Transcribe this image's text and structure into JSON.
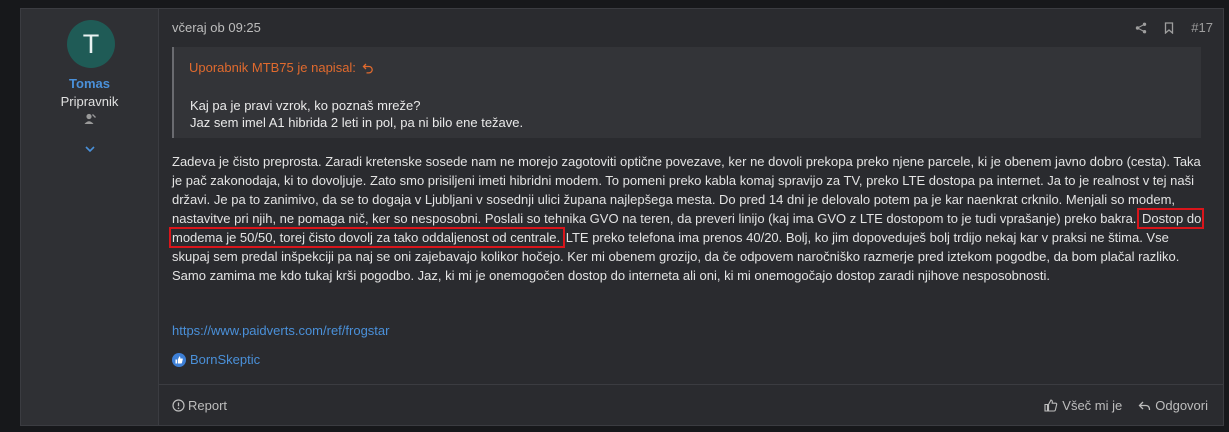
{
  "user": {
    "avatar_letter": "T",
    "avatar_color": "#1f5b56",
    "name": "Tomas",
    "title": "Pripravnik",
    "badge_icon": "user-badge-icon",
    "expand_icon": "chevron-down-icon"
  },
  "post": {
    "date": "včeraj ob 09:25",
    "number": "#17",
    "share_icon": "share-icon",
    "bookmark_icon": "bookmark-icon"
  },
  "quote": {
    "header": "Uporabnik MTB75 je napisal:",
    "header_color": "#e06a2e",
    "lines": [
      "Kaj pa je pravi vzrok, ko poznaš mreže?",
      "Jaz sem imel A1 hibrida 2 leti in pol, pa ni bilo ene težave."
    ]
  },
  "message": {
    "before": "Zadeva je čisto preprosta. Zaradi kretenske sosede nam ne morejo zagotoviti optične povezave, ker ne dovoli prekopa preko njene parcele, ki je obenem javno dobro (cesta). Taka je pač zakonodaja, ki to dovoljuje. Zato smo prisiljeni imeti hibridni modem. To pomeni preko kabla komaj spravijo za TV, preko LTE dostopa pa internet. Ja to je realnost v tej naši državi. Je pa to zanimivo, da se to dogaja v Ljubljani v sosednji ulici župana najlepšega mesta. Do pred 14 dni je delovalo potem pa je kar naenkrat crknilo. Menjali so modem, nastavitve pri njih, ne pomaga nič, ker so nesposobni. Poslali so tehnika GVO na teren, da preveri linijo (kaj ima GVO z LTE dostopom to je tudi vprašanje) preko bakra.",
    "highlight": "Dostop do modema je 50/50, torej čisto dovolj za tako oddaljenost od centrale.",
    "after": "LTE preko telefona ima prenos 40/20. Bolj, ko jim dopoveduješ bolj trdijo nekaj kar v praksi ne štima. Vse skupaj sem predal inšpekciji pa naj se oni zajebavajo kolikor hočejo. Ker mi obenem grozijo, da če odpovem naročniško razmerje pred iztekom pogodbe, da bom plačal razliko. Samo zamima me kdo tukaj krši pogodbo. Jaz, ki mi je onemogočen dostop do interneta ali oni, ki mi onemogočajo dostop zaradi njihove nesposobnosti.",
    "highlight_color": "#d9151b"
  },
  "signature": {
    "link": "https://www.paidverts.com/ref/frogstar"
  },
  "reactions": {
    "icon": "like-icon",
    "user": "BornSkeptic"
  },
  "footer": {
    "report": "Report",
    "like": "Všeč mi je",
    "reply": "Odgovori"
  }
}
